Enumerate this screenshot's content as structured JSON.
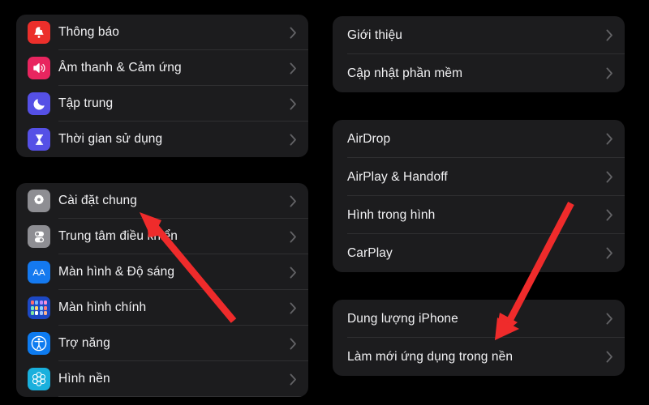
{
  "screen": {
    "background_color": "#000000",
    "card_color": "#1c1c1e",
    "separator_color": "#2f2f31",
    "label_color": "#f2f2f4",
    "chevron_color": "#636366",
    "annotation_arrow_color": "#ef2b2b"
  },
  "left_column": {
    "groups": [
      {
        "group_name": "notifications-group",
        "rows": [
          {
            "label": "Thông báo",
            "icon": "bell-icon",
            "icon_color": "#eb2f2b",
            "chevron": "chevron-right-icon"
          },
          {
            "label": "Âm thanh & Cảm ứng",
            "icon": "speaker-icon",
            "icon_color": "#e8255f",
            "chevron": "chevron-right-icon"
          },
          {
            "label": "Tập trung",
            "icon": "moon-icon",
            "icon_color": "#5550e6",
            "chevron": "chevron-right-icon"
          },
          {
            "label": "Thời gian sử dụng",
            "icon": "hourglass-icon",
            "icon_color": "#5550e6",
            "chevron": "chevron-right-icon"
          }
        ]
      },
      {
        "group_name": "general-group",
        "rows": [
          {
            "label": "Cài đặt chung",
            "icon": "gear-icon",
            "icon_color": "#8e8e93",
            "chevron": "chevron-right-icon"
          },
          {
            "label": "Trung tâm điều khiển",
            "icon": "control-center-icon",
            "icon_color": "#8e8e93",
            "chevron": "chevron-right-icon"
          },
          {
            "label": "Màn hình & Độ sáng",
            "icon": "display-aa-icon",
            "icon_color": "#1479ef",
            "chevron": "chevron-right-icon"
          },
          {
            "label": "Màn hình chính",
            "icon": "home-screen-icon",
            "icon_color": "#1c48c4",
            "chevron": "chevron-right-icon"
          },
          {
            "label": "Trợ năng",
            "icon": "accessibility-icon",
            "icon_color": "#0d7bf0",
            "chevron": "chevron-right-icon"
          },
          {
            "label": "Hình nền",
            "icon": "wallpaper-icon",
            "icon_color": "#19b0dd",
            "chevron": "chevron-right-icon"
          }
        ]
      }
    ]
  },
  "right_column": {
    "groups": [
      {
        "group_name": "about-group",
        "rows": [
          {
            "label": "Giới thiệu",
            "chevron": "chevron-right-icon"
          },
          {
            "label": "Cập nhật phần mềm",
            "chevron": "chevron-right-icon"
          }
        ]
      },
      {
        "group_name": "connectivity-group",
        "rows": [
          {
            "label": "AirDrop",
            "chevron": "chevron-right-icon"
          },
          {
            "label": "AirPlay & Handoff",
            "chevron": "chevron-right-icon"
          },
          {
            "label": "Hình trong hình",
            "chevron": "chevron-right-icon"
          },
          {
            "label": "CarPlay",
            "chevron": "chevron-right-icon"
          }
        ]
      },
      {
        "group_name": "storage-group",
        "rows": [
          {
            "label": "Dung lượng iPhone",
            "chevron": "chevron-right-icon"
          },
          {
            "label": "Làm mới ứng dụng trong nền",
            "chevron": "chevron-right-icon"
          }
        ]
      }
    ]
  },
  "annotations": [
    {
      "name": "arrow-pointing-to-cai-dat-chung",
      "target": "Cài đặt chung",
      "color": "#ef2b2b"
    },
    {
      "name": "arrow-pointing-to-lam-moi-ung-dung",
      "target": "Làm mới ứng dụng trong nền",
      "color": "#ef2b2b"
    }
  ]
}
